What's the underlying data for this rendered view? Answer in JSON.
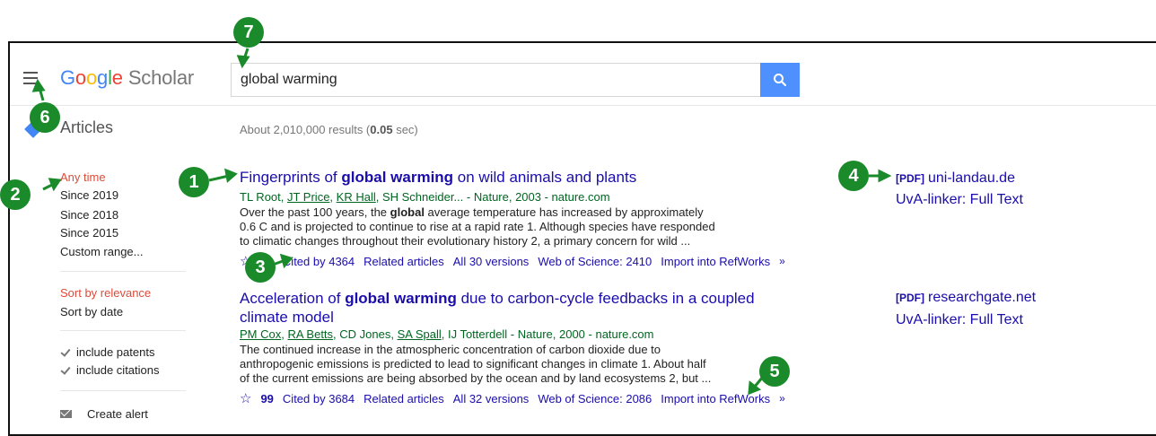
{
  "header": {
    "logo_parts": [
      "G",
      "o",
      "o",
      "g",
      "l",
      "e"
    ],
    "logo_product": "Scholar",
    "search": {
      "value": "global warming"
    }
  },
  "subheader": {
    "section_title": "Articles",
    "results_prefix": "About 2,010,000 results (",
    "results_time": "0.05",
    "results_suffix": " sec)"
  },
  "sidebar": {
    "time_filters": [
      "Any time",
      "Since 2019",
      "Since 2018",
      "Since 2015",
      "Custom range..."
    ],
    "sort_options": [
      "Sort by relevance",
      "Sort by date"
    ],
    "checkboxes": [
      "include patents",
      "include citations"
    ],
    "create_alert": "Create alert"
  },
  "results": [
    {
      "title_before": "Fingerprints of ",
      "title_bold": "global warming",
      "title_after": " on wild animals and plants",
      "authors_prefix": "TL Root, ",
      "author_links": [
        "JT Price",
        "KR Hall"
      ],
      "authors_suffix": ", SH Schneider... - Nature, 2003 - nature.com",
      "snippet_1a": "Over the past 100 years, the ",
      "snippet_1b": "global",
      "snippet_1c": " average temperature has increased by approximately",
      "snippet_2": "0.6 C and is projected to continue to rise at a rapid rate 1. Although species have responded",
      "snippet_3": "to climatic changes throughout their evolutionary history 2, a primary concern for wild ...",
      "cited_by": "Cited by 4364",
      "related": "Related articles",
      "versions": "All 30 versions",
      "wos": "Web of Science: 2410",
      "import": "Import into RefWorks",
      "pdf_tag": "[PDF]",
      "pdf_source": "uni-landau.de",
      "fulltext": "UvA-linker: Full Text"
    },
    {
      "title_before": "Acceleration of ",
      "title_bold": "global warming",
      "title_after": " due to carbon-cycle feedbacks in a coupled",
      "title_line2": "climate model",
      "author_links": [
        "PM Cox",
        "RA Betts"
      ],
      "authors_mid": ", CD Jones, ",
      "author_link3": "SA Spall",
      "authors_suffix": ", IJ Totterdell - Nature, 2000 - nature.com",
      "snippet_1": "The continued increase in the atmospheric concentration of carbon dioxide due to",
      "snippet_2": "anthropogenic emissions is predicted to lead to significant changes in climate 1. About half",
      "snippet_3": "of the current emissions are being absorbed by the ocean and by land ecosystems 2, but ...",
      "cited_by": "Cited by 3684",
      "related": "Related articles",
      "versions": "All 32 versions",
      "wos": "Web of Science: 2086",
      "import": "Import into RefWorks",
      "pdf_tag": "[PDF]",
      "pdf_source": "researchgate.net",
      "fulltext": "UvA-linker: Full Text"
    }
  ],
  "callouts": [
    "1",
    "2",
    "3",
    "4",
    "5",
    "6",
    "7"
  ],
  "colors": {
    "accent_green": "#1a8a2a",
    "link_blue": "#1a0dab",
    "author_green": "#006621",
    "active_red": "#dd4b39",
    "search_button_blue": "#4d90fe"
  }
}
